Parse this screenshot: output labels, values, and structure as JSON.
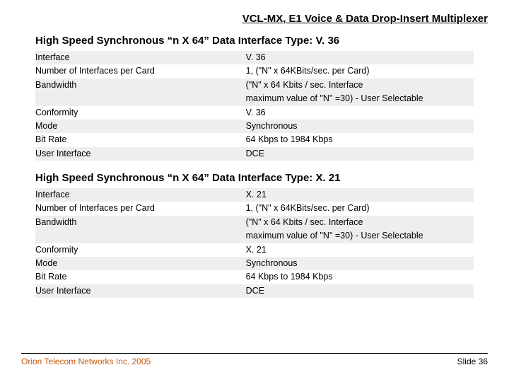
{
  "doc_title": "VCL-MX, E1 Voice & Data Drop-Insert Multiplexer",
  "sections": [
    {
      "title": "High Speed Synchronous  “n X 64” Data Interface Type: V. 36",
      "rows": [
        {
          "label": "Interface",
          "value": "V. 36",
          "shade": true
        },
        {
          "label": "Number of Interfaces per Card",
          "value": "1, (\"N\" x 64KBits/sec. per Card)",
          "shade": false
        },
        {
          "label": "Bandwidth",
          "value": "(\"N\" x 64 Kbits / sec. Interface\nmaximum value of \"N\" =30) - User Selectable",
          "shade": true
        },
        {
          "label": "Conformity",
          "value": "V. 36",
          "shade": false
        },
        {
          "label": "Mode",
          "value": "Synchronous",
          "shade": true
        },
        {
          "label": "Bit Rate",
          "value": "64 Kbps to 1984 Kbps",
          "shade": false
        },
        {
          "label": "User Interface",
          "value": "DCE",
          "shade": true
        }
      ]
    },
    {
      "title": "High Speed Synchronous  “n X 64” Data Interface Type: X. 21",
      "rows": [
        {
          "label": "Interface",
          "value": "X. 21",
          "shade": true
        },
        {
          "label": "Number of Interfaces per Card",
          "value": "1, (\"N\" x 64KBits/sec. per Card)",
          "shade": false
        },
        {
          "label": "Bandwidth",
          "value": "(\"N\" x 64 Kbits / sec. Interface\nmaximum value of \"N\" =30) - User Selectable",
          "shade": true
        },
        {
          "label": "Conformity",
          "value": "X. 21",
          "shade": false
        },
        {
          "label": "Mode",
          "value": "Synchronous",
          "shade": true
        },
        {
          "label": "Bit Rate",
          "value": "64 Kbps to 1984 Kbps",
          "shade": false
        },
        {
          "label": "User Interface",
          "value": "DCE",
          "shade": true
        }
      ]
    }
  ],
  "footer": {
    "company": "Orion Telecom Networks Inc. 2005",
    "slide": "Slide 36"
  }
}
